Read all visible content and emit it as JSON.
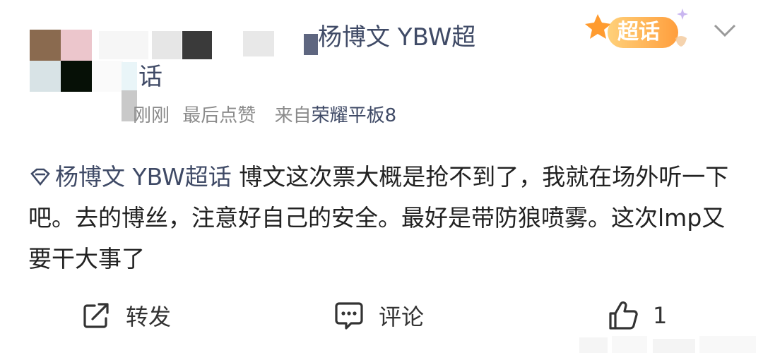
{
  "header": {
    "title_visible": "杨博文 YBW超",
    "title_wrap": "话",
    "time": "刚刚",
    "like_status": "最后点赞",
    "source_prefix": "来自",
    "device": "荣耀平板8",
    "badge_label": "超话"
  },
  "post": {
    "topic": "杨博文 YBW超话",
    "content": " 博文这次票大概是抢不到了，我就在场外听一下吧。去的博丝，注意好自己的安全。最好是带防狼喷雾。这次lmp又要干大事了"
  },
  "actions": {
    "repost_label": "转发",
    "comment_label": "评论",
    "like_count": "1"
  },
  "colors": {
    "link": "#3f4a66",
    "meta": "#8b8b8b",
    "badge_start": "#ffb347",
    "badge_end": "#ff8c1a"
  },
  "icons": [
    "share-icon",
    "comment-icon",
    "thumbs-up-icon",
    "chevron-down-icon",
    "topic-diamond-icon",
    "super-topic-badge-icon"
  ]
}
